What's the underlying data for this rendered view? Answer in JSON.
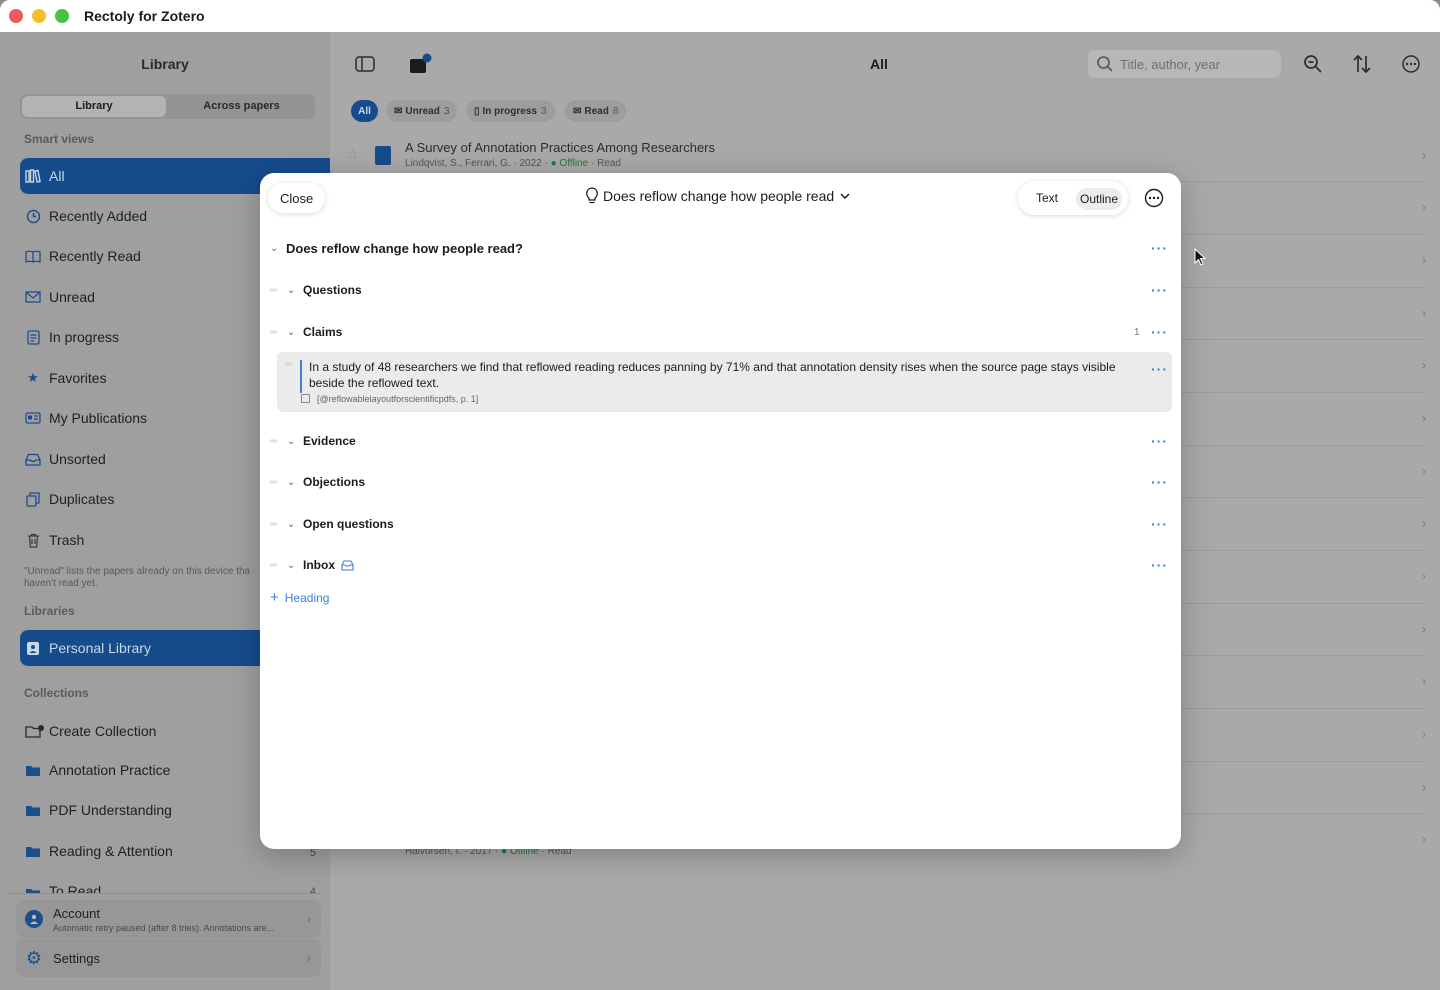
{
  "app": {
    "title": "Rectoly for Zotero"
  },
  "sidebar": {
    "title": "Library",
    "segments": [
      "Library",
      "Across papers"
    ],
    "smart_views_label": "Smart views",
    "smart_views": [
      {
        "label": "All",
        "icon": "library-icon",
        "count": ""
      },
      {
        "label": "Recently Added",
        "icon": "clock-icon"
      },
      {
        "label": "Recently Read",
        "icon": "book-icon"
      },
      {
        "label": "Unread",
        "icon": "envelope-icon"
      },
      {
        "label": "In progress",
        "icon": "document-icon"
      },
      {
        "label": "Favorites",
        "icon": "star-icon"
      },
      {
        "label": "My Publications",
        "icon": "id-card-icon"
      },
      {
        "label": "Unsorted",
        "icon": "tray-icon"
      },
      {
        "label": "Duplicates",
        "icon": "duplicate-icon"
      },
      {
        "label": "Trash",
        "icon": "trash-icon"
      }
    ],
    "note": "\"Unread\" lists the papers already on this device tha haven't read yet.",
    "libraries_label": "Libraries",
    "libraries": [
      {
        "label": "Personal Library"
      }
    ],
    "collections_label": "Collections",
    "collections": [
      {
        "label": "Create Collection",
        "count": ""
      },
      {
        "label": "Annotation Practice",
        "count": ""
      },
      {
        "label": "PDF Understanding",
        "count": ""
      },
      {
        "label": "Reading & Attention",
        "count": "5"
      },
      {
        "label": "To Read",
        "count": "4"
      }
    ],
    "account": {
      "title": "Account",
      "subtitle": "Automatic retry paused (after 8 tries). Annotations are..."
    },
    "settings": {
      "label": "Settings"
    }
  },
  "main": {
    "title": "All",
    "search_placeholder": "Title, author, year",
    "filters": [
      {
        "label": "All",
        "count": ""
      },
      {
        "label": "Unread",
        "count": "3"
      },
      {
        "label": "In progress",
        "count": "3"
      },
      {
        "label": "Read",
        "count": "8"
      }
    ],
    "first_paper": {
      "title": "A Survey of Annotation Practices Among Researchers",
      "authors": "Lindqvist, S., Ferrari, G.",
      "year": "2022",
      "status": "Offline",
      "state": "Read"
    },
    "last_paper": {
      "authors": "Halvorsen, I.",
      "year": "2017",
      "status": "Offline",
      "state": "Read"
    }
  },
  "modal": {
    "close_label": "Close",
    "title": "Does reflow change how people read",
    "view_text": "Text",
    "view_outline": "Outline",
    "root_heading": "Does reflow change how people read?",
    "sections": [
      {
        "label": "Questions",
        "count": ""
      },
      {
        "label": "Claims",
        "count": "1"
      },
      {
        "label": "Evidence",
        "count": ""
      },
      {
        "label": "Objections",
        "count": ""
      },
      {
        "label": "Open questions",
        "count": ""
      },
      {
        "label": "Inbox",
        "count": ""
      }
    ],
    "claim": {
      "text": "In a study of 48 researchers we find that reflowed reading reduces panning by 71% and that annotation density rises when the source page stays visible beside the reflowed text.",
      "citation": "[@reflowablelayoutforscientificpdfs, p. 1]"
    },
    "add_heading_label": "Heading",
    "more_dots": "···"
  },
  "colors": {
    "accent": "#3d7fd9",
    "selected": "#164c8c",
    "offline": "#1c7a3a"
  }
}
